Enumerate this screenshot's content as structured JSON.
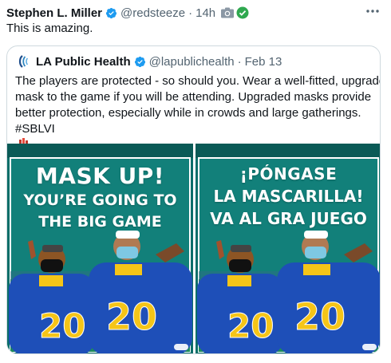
{
  "tweet": {
    "author_name": "Stephen L. Miller",
    "author_handle": "@redsteeze",
    "separator": "·",
    "time": "14h",
    "text": "This is amazing."
  },
  "quote": {
    "author_name": "LA Public Health",
    "author_handle": "@lapublichealth",
    "separator": "·",
    "date": "Feb 13",
    "text_lines": [
      "The players are protected - so should you. Wear a well-fitted, upgraded",
      "mask to the game if you will be attending. Upgraded masks provide",
      "better protection, especially while in crowds and large gatherings."
    ],
    "hashtag": "#SBLVI"
  },
  "media": {
    "english": {
      "line1": "MASK UP!",
      "line2": "YOU’RE GOING TO",
      "line3": "THE BIG GAME",
      "jersey_number": "20"
    },
    "spanish": {
      "line1": "¡PÓNGASE",
      "line2": "LA MASCARILLA!",
      "line3": "VA AL GRA JUEGO",
      "jersey_number": "20"
    }
  },
  "colors": {
    "verified_blue": "#1d9bf0",
    "secondary_text": "#536471",
    "poster_teal": "#0d6f6a",
    "jersey_blue": "#1e4fb8",
    "jersey_yellow": "#f5c518",
    "check_green": "#2fa84f"
  },
  "icons": {
    "verified": "verified-badge-icon",
    "camera": "camera-icon",
    "check": "green-check-icon",
    "more": "more-options-icon",
    "trophy": "trophy-emoji-icon"
  }
}
